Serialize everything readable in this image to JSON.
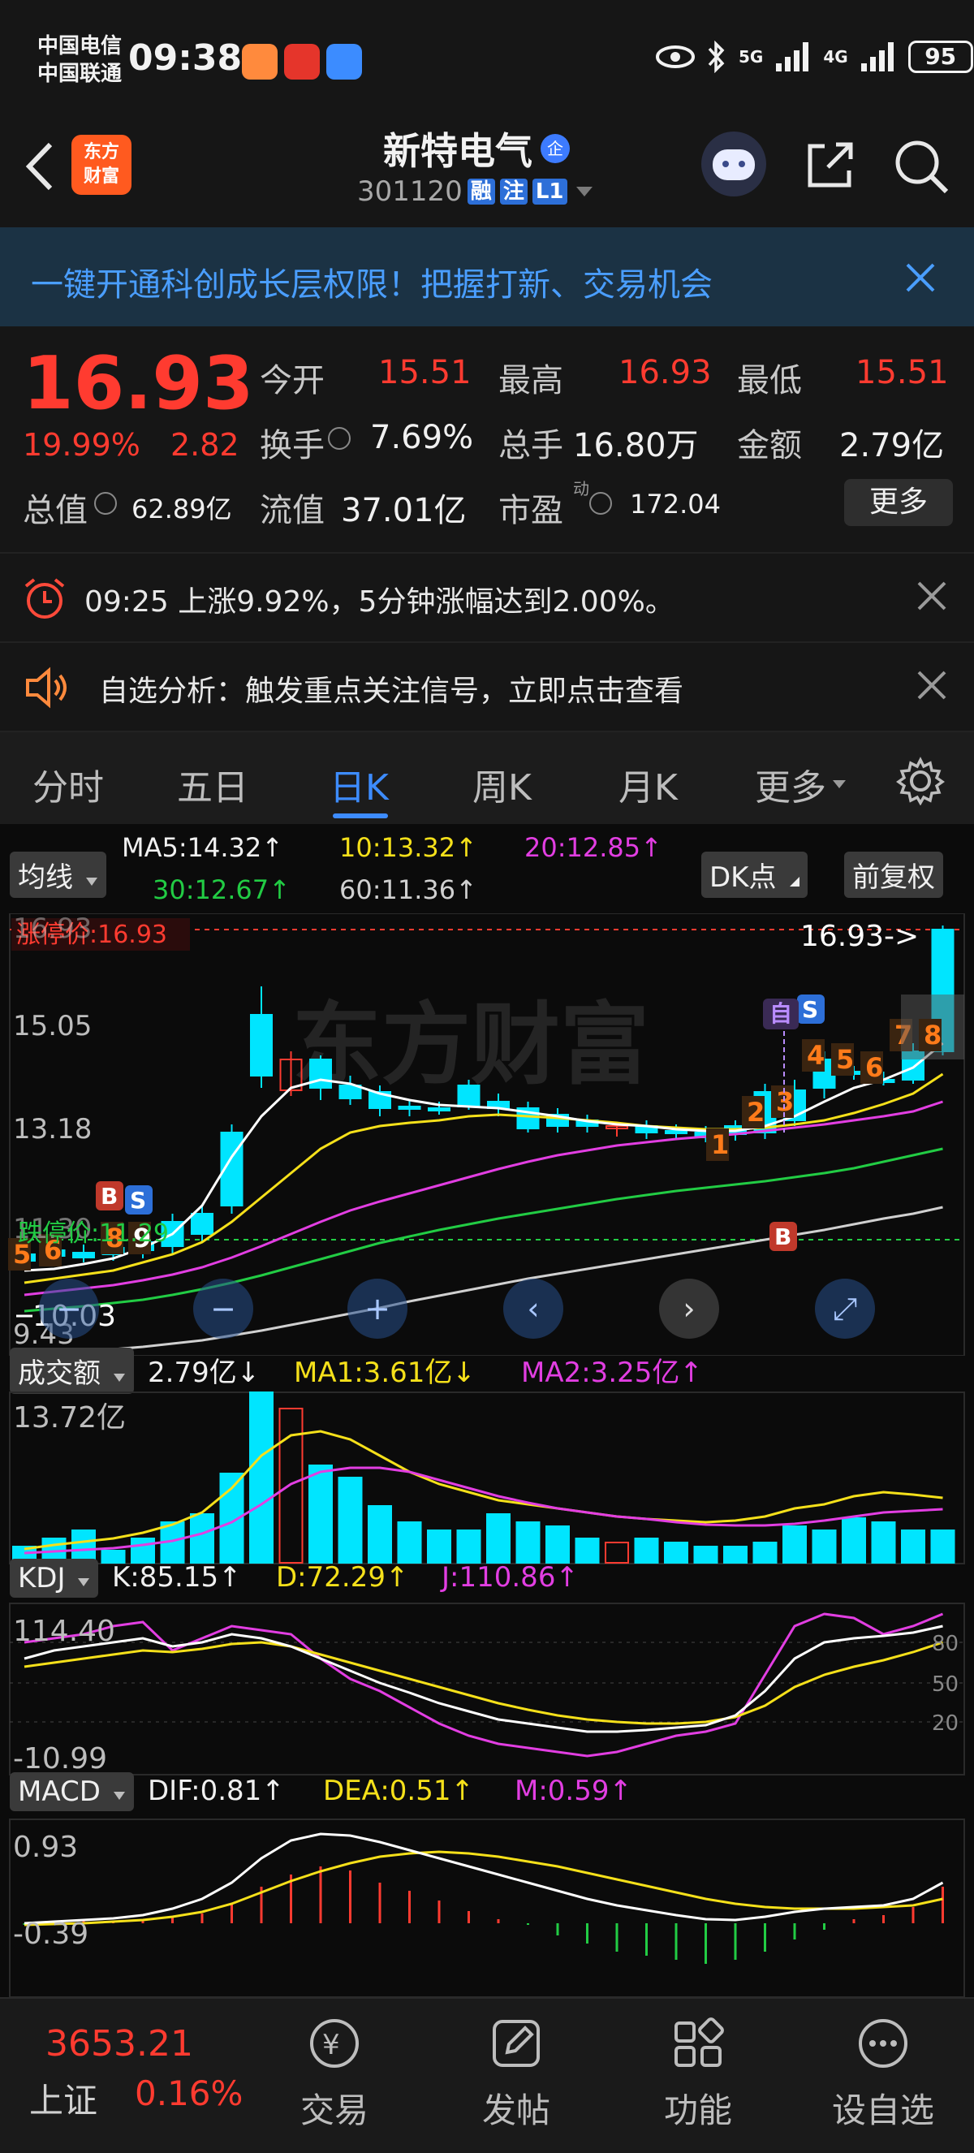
{
  "status": {
    "carrier1": "中国电信",
    "carrier2": "中国联通",
    "time": "09:38",
    "network1": "5G",
    "network2": "4G",
    "battery": "95"
  },
  "header": {
    "logo_text1": "东方",
    "logo_text2": "财富",
    "stock_name": "新特电气",
    "name_badge": "企",
    "stock_code": "301120",
    "badge_rong": "融",
    "badge_zhu": "注",
    "badge_l1": "L1"
  },
  "banner": {
    "text": "一键开通科创成长层权限！把握打新、交易机会"
  },
  "quote": {
    "price": "16.93",
    "change_pct": "19.99%",
    "change_amt": "2.82",
    "open_label": "今开",
    "open": "15.51",
    "high_label": "最高",
    "high": "16.93",
    "low_label": "最低",
    "low": "15.51",
    "turnover_label": "换手",
    "turnover": "7.69%",
    "volume_label": "总手",
    "volume": "16.80万",
    "amount_label": "金额",
    "amount": "2.79亿",
    "mktcap_label": "总值",
    "mktcap": "62.89亿",
    "float_label": "流值",
    "float": "37.01亿",
    "pe_label": "市盈",
    "pe_sup": "动",
    "pe": "172.04",
    "more_label": "更多"
  },
  "alerts": [
    {
      "text": "09:25 上涨9.92%，5分钟涨幅达到2.00%。"
    },
    {
      "text": "自选分析：触发重点关注信号，立即点击查看"
    }
  ],
  "tabs": [
    {
      "label": "分时"
    },
    {
      "label": "五日"
    },
    {
      "label": "日K"
    },
    {
      "label": "周K"
    },
    {
      "label": "月K"
    },
    {
      "label": "更多"
    }
  ],
  "kline": {
    "ma_selector": "均线",
    "ma5": "MA5:14.32↑",
    "ma10": "10:13.32↑",
    "ma20": "20:12.85↑",
    "ma30": "30:12.67↑",
    "ma60": "60:11.36↑",
    "dk_label": "DK点",
    "adj_label": "前复权",
    "limit_up_label": "涨停价:16.93",
    "limit_down_label": "跌停价:11.29",
    "y_top": "16.93",
    "y_mid1": "15.05",
    "y_mid2": "13.18",
    "y_mid3": "11.30",
    "y_bottom": "9.43",
    "last_price_arrow": "16.93->",
    "min_marker": "10.03",
    "marker_zi": "自",
    "colors": {
      "up": "#ff3b30",
      "down": "#00e5ff",
      "ma5": "#ffffff",
      "ma10": "#f5e01a",
      "ma20": "#e23ee2",
      "ma30": "#22cc44",
      "ma60": "#d0d0d0"
    }
  },
  "volume_panel": {
    "selector": "成交额",
    "value": "2.79亿↓",
    "ma1": "MA1:3.61亿↓",
    "ma2": "MA2:3.25亿↑",
    "y_top": "13.72亿"
  },
  "kdj_panel": {
    "selector": "KDJ",
    "k": "K:85.15↑",
    "d": "D:72.29↑",
    "j": "J:110.86↑",
    "y_top": "114.40",
    "y_bottom": "-10.99",
    "lvl80": "80",
    "lvl50": "50",
    "lvl20": "20"
  },
  "macd_panel": {
    "selector": "MACD",
    "dif": "DIF:0.81↑",
    "dea": "DEA:0.51↑",
    "m": "M:0.59↑",
    "y_top": "0.93",
    "y_bottom": "-0.39"
  },
  "bottomnav": {
    "index_value": "3653.21",
    "index_name": "上证",
    "index_change": "0.16%",
    "items": [
      {
        "label": "交易"
      },
      {
        "label": "发帖"
      },
      {
        "label": "功能"
      },
      {
        "label": "设自选"
      }
    ]
  }
}
